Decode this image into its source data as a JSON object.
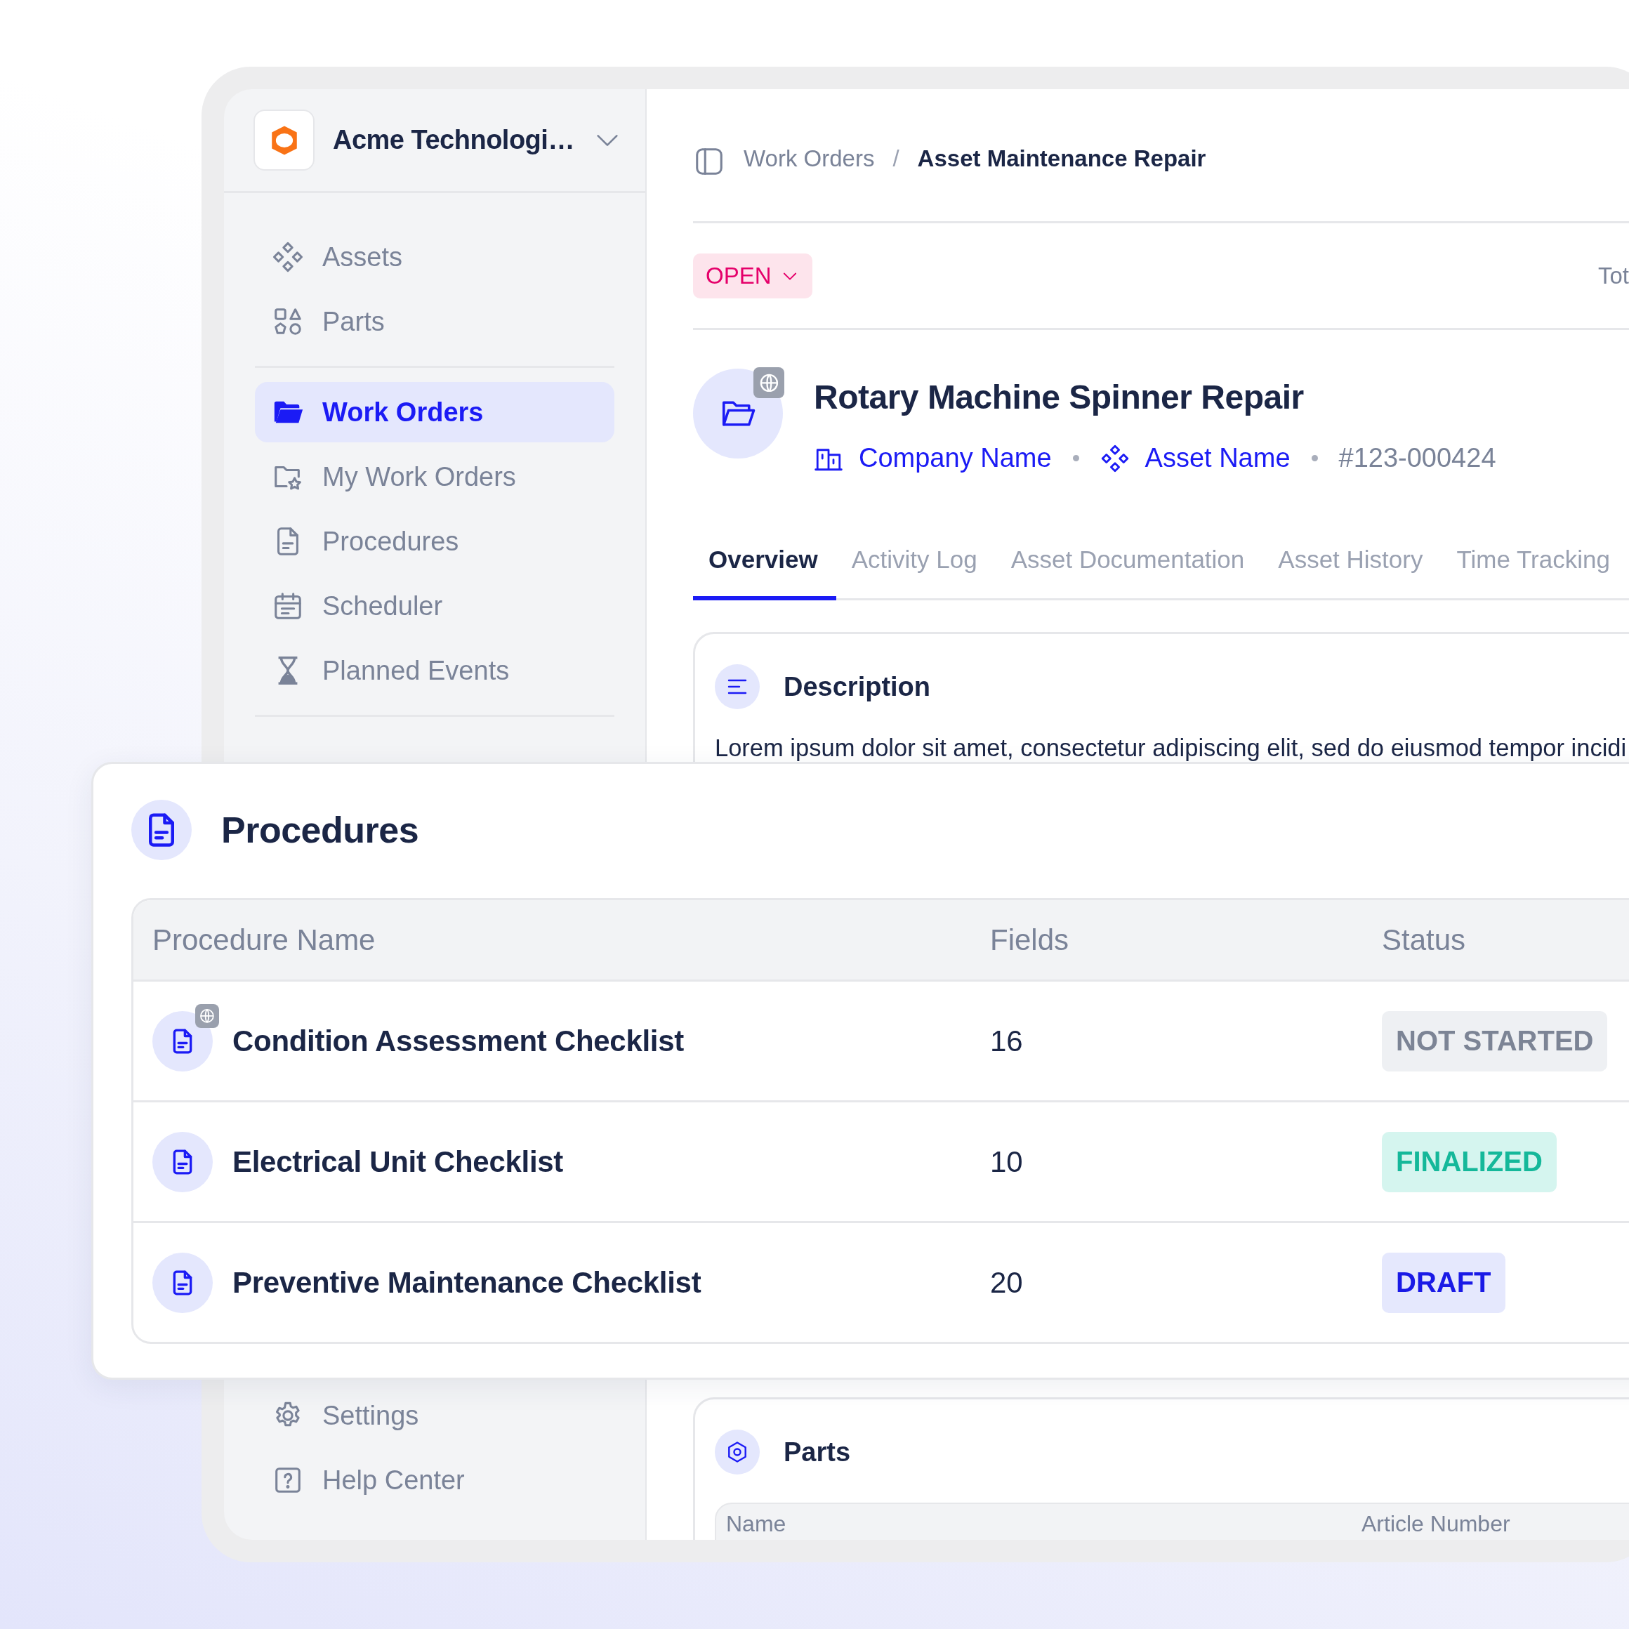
{
  "sidebar": {
    "org_name": "Acme Technologi…",
    "sections": [
      {
        "items": [
          {
            "label": "Assets",
            "selected": false
          },
          {
            "label": "Parts",
            "selected": false
          }
        ]
      },
      {
        "items": [
          {
            "label": "Work Orders",
            "selected": true
          },
          {
            "label": "My Work Orders",
            "selected": false
          },
          {
            "label": "Procedures",
            "selected": false
          },
          {
            "label": "Scheduler",
            "selected": false
          },
          {
            "label": "Planned Events",
            "selected": false
          }
        ]
      }
    ],
    "footer_items": [
      {
        "label": "Settings",
        "selected": false
      },
      {
        "label": "Help Center",
        "selected": false
      }
    ]
  },
  "breadcrumb": {
    "separator": "/",
    "items": [
      {
        "label": "Work Orders",
        "current": false
      },
      {
        "label": "Asset Maintenance Repair",
        "current": true
      }
    ]
  },
  "status": {
    "label": "OPEN",
    "side_text": "Tot"
  },
  "work_order": {
    "title": "Rotary Machine Spinner Repair",
    "shared": true,
    "company": "Company Name",
    "asset": "Asset Name",
    "number": "#123-000424"
  },
  "tabs": [
    {
      "label": "Overview",
      "selected": true
    },
    {
      "label": "Activity Log",
      "selected": false
    },
    {
      "label": "Asset Documentation",
      "selected": false
    },
    {
      "label": "Asset History",
      "selected": false
    },
    {
      "label": "Time Tracking",
      "selected": false
    }
  ],
  "description": {
    "title": "Description",
    "text": "Lorem ipsum dolor sit amet, consectetur adipiscing elit, sed do eiusmod tempor incidi"
  },
  "parts": {
    "title": "Parts",
    "columns": [
      "Name",
      "Article Number"
    ]
  },
  "procedures": {
    "title": "Procedures",
    "columns": [
      "Procedure Name",
      "Fields",
      "Status"
    ],
    "rows": [
      {
        "name": "Condition Assessment Checklist",
        "shared": true,
        "fields": "16",
        "status": {
          "label": "NOT STARTED",
          "kind": "not_started"
        }
      },
      {
        "name": "Electrical Unit Checklist",
        "shared": false,
        "fields": "10",
        "status": {
          "label": "FINALIZED",
          "kind": "finalized"
        }
      },
      {
        "name": "Preventive Maintenance Checklist",
        "shared": false,
        "fields": "20",
        "status": {
          "label": "DRAFT",
          "kind": "draft"
        }
      }
    ]
  }
}
